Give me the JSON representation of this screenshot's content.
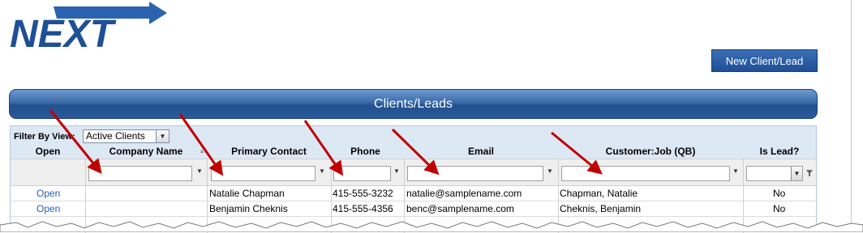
{
  "header": {
    "logo_text": "NEXT",
    "new_button_label": "New Client/Lead"
  },
  "panel": {
    "title": "Clients/Leads"
  },
  "filter": {
    "label": "Filter By View:",
    "selected_view": "Active Clients"
  },
  "columns": {
    "open": "Open",
    "company": "Company Name",
    "contact": "Primary Contact",
    "phone": "Phone",
    "email": "Email",
    "customer_job": "Customer:Job (QB)",
    "is_lead": "Is Lead?"
  },
  "rows": [
    {
      "open": "Open",
      "company": "",
      "contact": "Natalie Chapman",
      "phone": "415-555-3232",
      "email": "natalie@samplename.com",
      "customer_job": "Chapman, Natalie",
      "is_lead": "No"
    },
    {
      "open": "Open",
      "company": "",
      "contact": "Benjamin Cheknis",
      "phone": "415-555-4356",
      "email": "benc@samplename.com",
      "customer_job": "Cheknis, Benjamin",
      "is_lead": "No"
    }
  ],
  "icons": {
    "dropdown": "chevron-down-icon",
    "filter": "funnel-icon",
    "annotation_arrow": "red-arrow-icon"
  },
  "colors": {
    "accent": "#2a5a9c",
    "link": "#2860b0",
    "annotation": "#c00000"
  }
}
